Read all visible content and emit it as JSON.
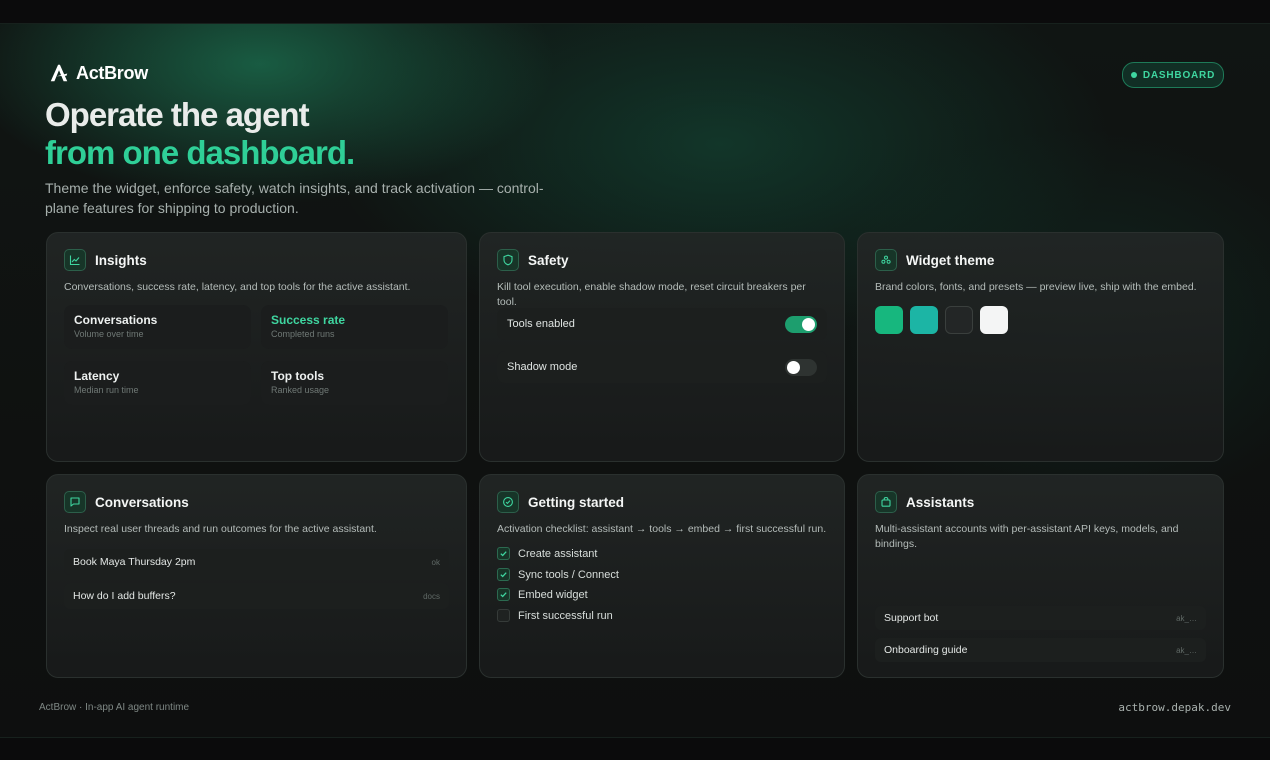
{
  "brand": {
    "name": "ActBrow"
  },
  "badge": {
    "label": "DASHBOARD"
  },
  "hero": {
    "title_line1": "Operate the agent",
    "title_line2": "from one dashboard.",
    "subtitle": "Theme the widget, enforce safety, watch insights, and track activation — control-plane features for shipping to production."
  },
  "colors": {
    "accent": "#2fcf97",
    "toggle_on": "#1d9e6e",
    "background": "#0f1110"
  },
  "insights": {
    "title": "Insights",
    "icon": "chart-line-icon",
    "description": "Conversations, success rate, latency, and top tools for the active assistant.",
    "tiles": [
      {
        "title": "Conversations",
        "subtitle": "Volume over time"
      },
      {
        "title": "Success rate",
        "subtitle": "Completed runs"
      },
      {
        "title": "Latency",
        "subtitle": "Median run time"
      },
      {
        "title": "Top tools",
        "subtitle": "Ranked usage"
      }
    ]
  },
  "safety": {
    "title": "Safety",
    "icon": "shield-icon",
    "description": "Kill tool execution, enable shadow mode, reset circuit breakers per tool.",
    "toggles": [
      {
        "label": "Tools enabled",
        "on": true
      },
      {
        "label": "Shadow mode",
        "on": false
      }
    ]
  },
  "theme": {
    "title": "Widget theme",
    "icon": "palette-icon",
    "description": "Brand colors, fonts, and presets — preview live, ship with the embed.",
    "swatches": [
      "#17b77e",
      "#1cb5a5",
      "#232626",
      "#f4f5f5"
    ]
  },
  "conversations": {
    "title": "Conversations",
    "icon": "chat-icon",
    "description": "Inspect real user threads and run outcomes for the active assistant.",
    "items": [
      {
        "text": "Book Maya Thursday 2pm",
        "tag": "ok"
      },
      {
        "text": "How do I add buffers?",
        "tag": "docs"
      }
    ]
  },
  "getting_started": {
    "title": "Getting started",
    "icon": "check-circle-icon",
    "description": "Activation checklist: assistant → tools → embed → first successful run.",
    "steps": [
      {
        "label": "Create assistant",
        "done": true
      },
      {
        "label": "Sync tools / Connect",
        "done": true
      },
      {
        "label": "Embed widget",
        "done": true
      },
      {
        "label": "First successful run",
        "done": false
      }
    ]
  },
  "assistants": {
    "title": "Assistants",
    "icon": "bag-icon",
    "description": "Multi-assistant accounts with per-assistant API keys, models, and bindings.",
    "items": [
      {
        "name": "Support bot",
        "key": "ak_…"
      },
      {
        "name": "Onboarding guide",
        "key": "ak_…"
      }
    ]
  },
  "footer": {
    "left": "ActBrow · In-app AI agent runtime",
    "right": "actbrow.depak.dev"
  }
}
